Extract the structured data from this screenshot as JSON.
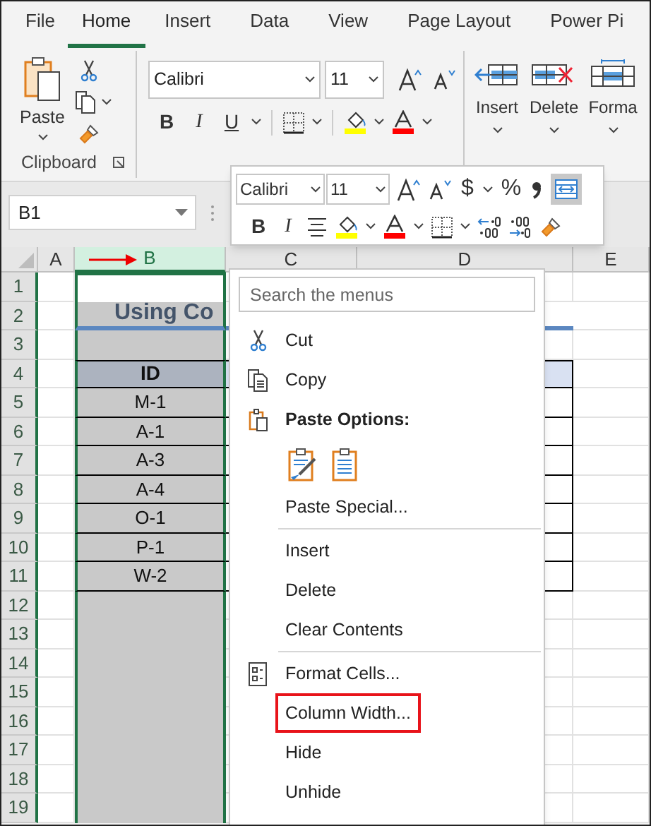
{
  "tabs": [
    {
      "label": "File",
      "selected": false
    },
    {
      "label": "Home",
      "selected": true
    },
    {
      "label": "Insert",
      "selected": false
    },
    {
      "label": "Data",
      "selected": false
    },
    {
      "label": "View",
      "selected": false
    },
    {
      "label": "Page Layout",
      "selected": false
    },
    {
      "label": "Power Pi",
      "selected": false
    }
  ],
  "clipboard": {
    "paste": "Paste",
    "group": "Clipboard"
  },
  "font_group": {
    "font": "Calibri",
    "size": "11",
    "format_buttons": [
      "B",
      "I",
      "U"
    ]
  },
  "cells_group": {
    "buttons": [
      "Insert",
      "Delete",
      "Forma"
    ]
  },
  "mini_toolbar": {
    "font": "Calibri",
    "size": "11",
    "currency": "$",
    "percent": "%",
    "format_buttons": [
      "B",
      "I"
    ]
  },
  "name_box": "B1",
  "columns": [
    {
      "label": "A",
      "selected": false
    },
    {
      "label": "B",
      "selected": true
    },
    {
      "label": "C",
      "selected": false
    },
    {
      "label": "D",
      "selected": false
    },
    {
      "label": "E",
      "selected": false
    }
  ],
  "rows": [
    "1",
    "2",
    "3",
    "4",
    "5",
    "6",
    "7",
    "8",
    "9",
    "10",
    "11",
    "12",
    "13",
    "14",
    "15",
    "16",
    "17",
    "18",
    "19"
  ],
  "sheet": {
    "title": "Using Co",
    "header": "ID",
    "ids": [
      "M-1",
      "A-1",
      "A-3",
      "A-4",
      "O-1",
      "P-1",
      "W-2"
    ]
  },
  "context_menu": {
    "search_placeholder": "Search the menus",
    "items": [
      {
        "kind": "command",
        "label": "Cut",
        "highlighted": false
      },
      {
        "kind": "command",
        "label": "Copy",
        "highlighted": false
      },
      {
        "kind": "heading",
        "label": "Paste Options:"
      },
      {
        "kind": "paste_options"
      },
      {
        "kind": "command",
        "label": "Paste Special...",
        "highlighted": false
      },
      {
        "kind": "separator"
      },
      {
        "kind": "command",
        "label": "Insert",
        "highlighted": false
      },
      {
        "kind": "command",
        "label": "Delete",
        "highlighted": false
      },
      {
        "kind": "command",
        "label": "Clear Contents",
        "highlighted": false
      },
      {
        "kind": "separator"
      },
      {
        "kind": "command",
        "label": "Format Cells...",
        "highlighted": false
      },
      {
        "kind": "command",
        "label": "Column Width...",
        "highlighted": true
      },
      {
        "kind": "command",
        "label": "Hide",
        "highlighted": false
      },
      {
        "kind": "command",
        "label": "Unhide",
        "highlighted": false
      }
    ]
  }
}
